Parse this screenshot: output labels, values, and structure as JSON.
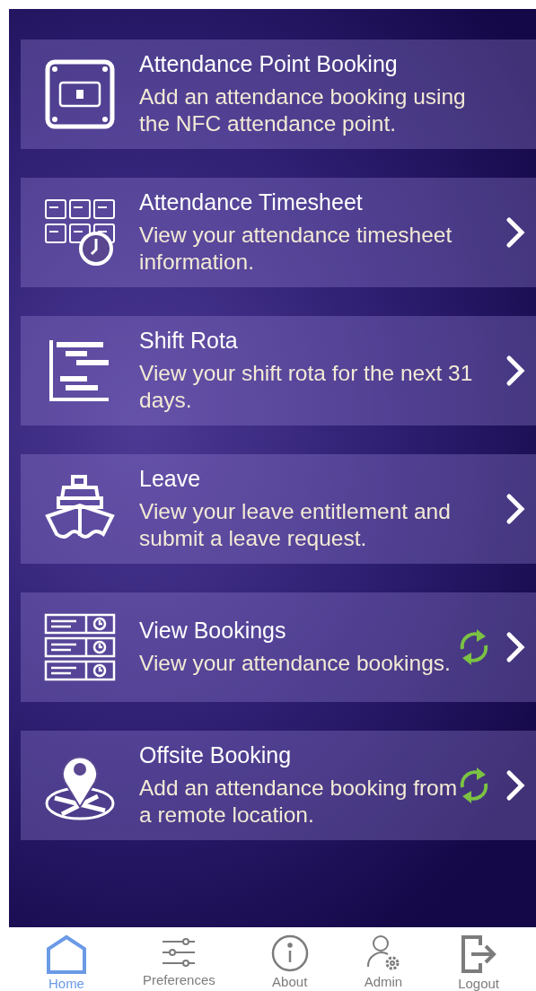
{
  "items": [
    {
      "kind": "nfc",
      "title": "Attendance Point Booking",
      "description": "Add an attendance booking using the NFC attendance point.",
      "sync": false,
      "chevron": false
    },
    {
      "kind": "timesheet",
      "title": "Attendance Timesheet",
      "description": "View your attendance timesheet information.",
      "sync": false,
      "chevron": true
    },
    {
      "kind": "rota",
      "title": "Shift Rota",
      "description": "View your shift rota for the next 31 days.",
      "sync": false,
      "chevron": true
    },
    {
      "kind": "ship",
      "title": "Leave",
      "description": "View your leave entitlement and submit a leave request.",
      "sync": false,
      "chevron": true
    },
    {
      "kind": "bookings",
      "title": "View Bookings",
      "description": "View your attendance bookings.",
      "sync": true,
      "chevron": true
    },
    {
      "kind": "location",
      "title": "Offsite Booking",
      "description": "Add an attendance booking from a remote location.",
      "sync": true,
      "chevron": true
    }
  ],
  "tabs": [
    {
      "kind": "home",
      "label": "Home",
      "selected": true
    },
    {
      "kind": "sliders",
      "label": "Preferences",
      "selected": false
    },
    {
      "kind": "info",
      "label": "About",
      "selected": false
    },
    {
      "kind": "admin",
      "label": "Admin",
      "selected": false
    },
    {
      "kind": "logout",
      "label": "Logout",
      "selected": false
    }
  ]
}
